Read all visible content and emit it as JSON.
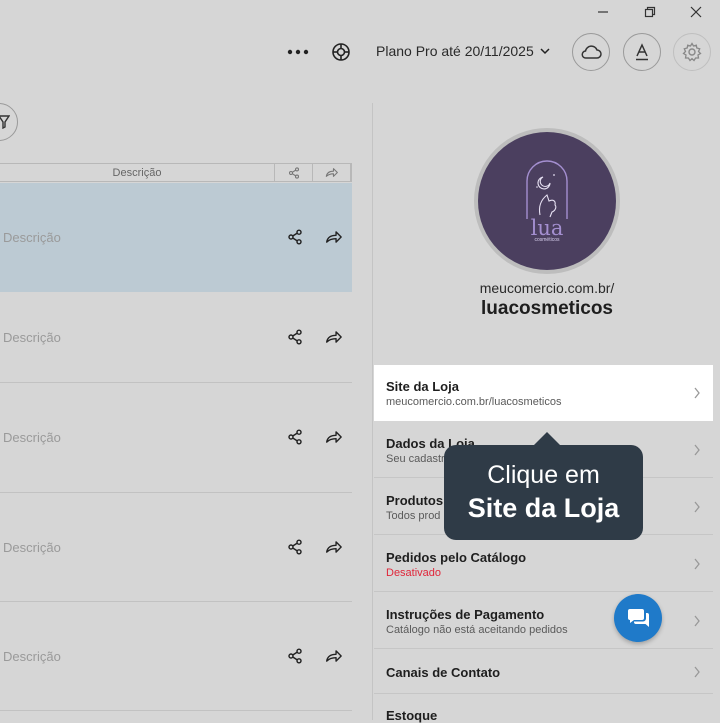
{
  "topbar": {
    "plan_label": "Plano Pro até 20/11/2025"
  },
  "table": {
    "header_description": "Descrição",
    "rows": [
      {
        "description": "Descrição"
      },
      {
        "description": "Descrição"
      },
      {
        "description": "Descrição"
      },
      {
        "description": "Descrição"
      },
      {
        "description": "Descrição"
      }
    ]
  },
  "store": {
    "logo_text": "lua",
    "logo_subtext": "cosméticos",
    "url_prefix": "meucomercio.com.br/",
    "name": "luacosmeticos"
  },
  "menu": [
    {
      "title": "Site da Loja",
      "subtitle": "meucomercio.com.br/luacosmeticos"
    },
    {
      "title": "Dados da Loja",
      "subtitle": "Seu cadastro"
    },
    {
      "title": "Produtos",
      "subtitle": "Todos prod"
    },
    {
      "title": "Pedidos pelo Catálogo",
      "subtitle": "Desativado"
    },
    {
      "title": "Instruções de Pagamento",
      "subtitle": "Catálogo não está aceitando pedidos"
    },
    {
      "title": "Canais de Contato",
      "subtitle": ""
    },
    {
      "title": "Estoque",
      "subtitle": ""
    }
  ],
  "tooltip": {
    "line1": "Clique em",
    "line2": "Site da Loja"
  },
  "colors": {
    "highlight_row": "#bccad3",
    "tooltip_bg": "#2f3b47",
    "status_red": "#e0263a",
    "chat_blue": "#1f7ac9",
    "logo_purple": "#4b3f5f"
  }
}
